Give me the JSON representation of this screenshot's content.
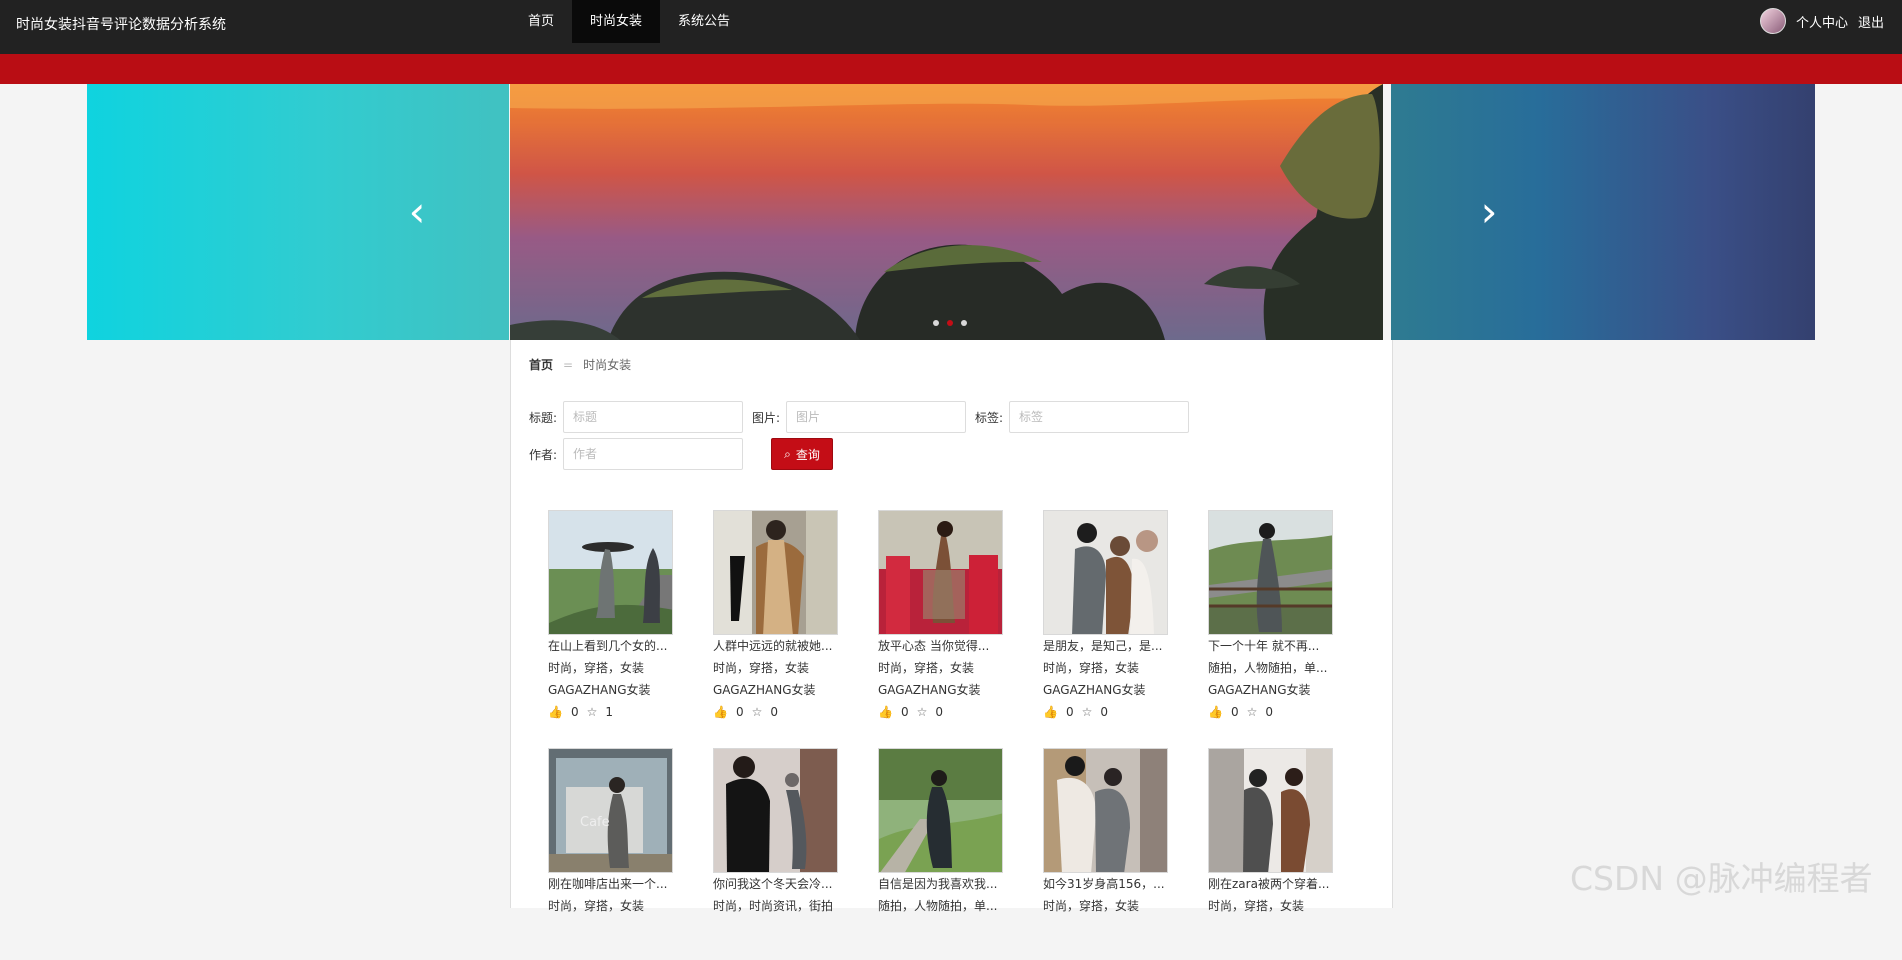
{
  "app": {
    "title": "时尚女装抖音号评论数据分析系统"
  },
  "nav": {
    "items": [
      "首页",
      "时尚女装",
      "系统公告"
    ],
    "active": "时尚女装"
  },
  "user": {
    "profile_label": "个人中心",
    "logout_label": "退出"
  },
  "carousel": {
    "prev_icon": "chevron-left-icon",
    "next_icon": "chevron-right-icon",
    "active_dot": 1,
    "dot_count": 3
  },
  "breadcrumb": {
    "home": "首页",
    "separator": "=",
    "current": "时尚女装"
  },
  "search": {
    "fields": [
      {
        "label": "标题:",
        "placeholder": "标题"
      },
      {
        "label": "图片:",
        "placeholder": "图片"
      },
      {
        "label": "标签:",
        "placeholder": "标签"
      },
      {
        "label": "作者:",
        "placeholder": "作者"
      }
    ],
    "button_label": "查询",
    "button_icon": "search-icon"
  },
  "cards": [
    {
      "title": "在山上看到几个女的...",
      "tags": "时尚，穿搭，女装",
      "author": "GAGAZHANG女装",
      "likes": "0",
      "favorites": "1",
      "image_style": "mountain-road"
    },
    {
      "title": "人群中远远的就被她...",
      "tags": "时尚，穿搭，女装",
      "author": "GAGAZHANG女装",
      "likes": "0",
      "favorites": "0",
      "image_style": "brown-cape"
    },
    {
      "title": "放平心态 当你觉得...",
      "tags": "时尚，穿搭，女装",
      "author": "GAGAZHANG女装",
      "likes": "0",
      "favorites": "0",
      "image_style": "red-train"
    },
    {
      "title": "是朋友，是知己，是...",
      "tags": "时尚，穿搭，女装",
      "author": "GAGAZHANG女装",
      "likes": "0",
      "favorites": "0",
      "image_style": "friends"
    },
    {
      "title": "下一个十年 就不再...",
      "tags": "随拍，人物随拍，单...",
      "author": "GAGAZHANG女装",
      "likes": "0",
      "favorites": "0",
      "image_style": "landscape"
    },
    {
      "title": "刚在咖啡店出来一个...",
      "tags": "时尚，穿搭，女装",
      "author": "",
      "likes": "",
      "favorites": "",
      "image_style": "coffee-shop"
    },
    {
      "title": "你问我这个冬天会冷...",
      "tags": "时尚，时尚资讯，街拍",
      "author": "",
      "likes": "",
      "favorites": "",
      "image_style": "black-jacket"
    },
    {
      "title": "自信是因为我喜欢我...",
      "tags": "随拍，人物随拍，单...",
      "author": "",
      "likes": "",
      "favorites": "",
      "image_style": "park"
    },
    {
      "title": "如今31岁身高156，...",
      "tags": "时尚，穿搭，女装",
      "author": "",
      "likes": "",
      "favorites": "",
      "image_style": "store"
    },
    {
      "title": "刚在zara被两个穿着...",
      "tags": "时尚，穿搭，女装",
      "author": "",
      "likes": "",
      "favorites": "",
      "image_style": "zara"
    }
  ],
  "watermark": "CSDN @脉冲编程者",
  "colors": {
    "topbar": "#222222",
    "accent": "#c40d16",
    "redbar": "#b90d14",
    "background": "#f4f4f4"
  }
}
